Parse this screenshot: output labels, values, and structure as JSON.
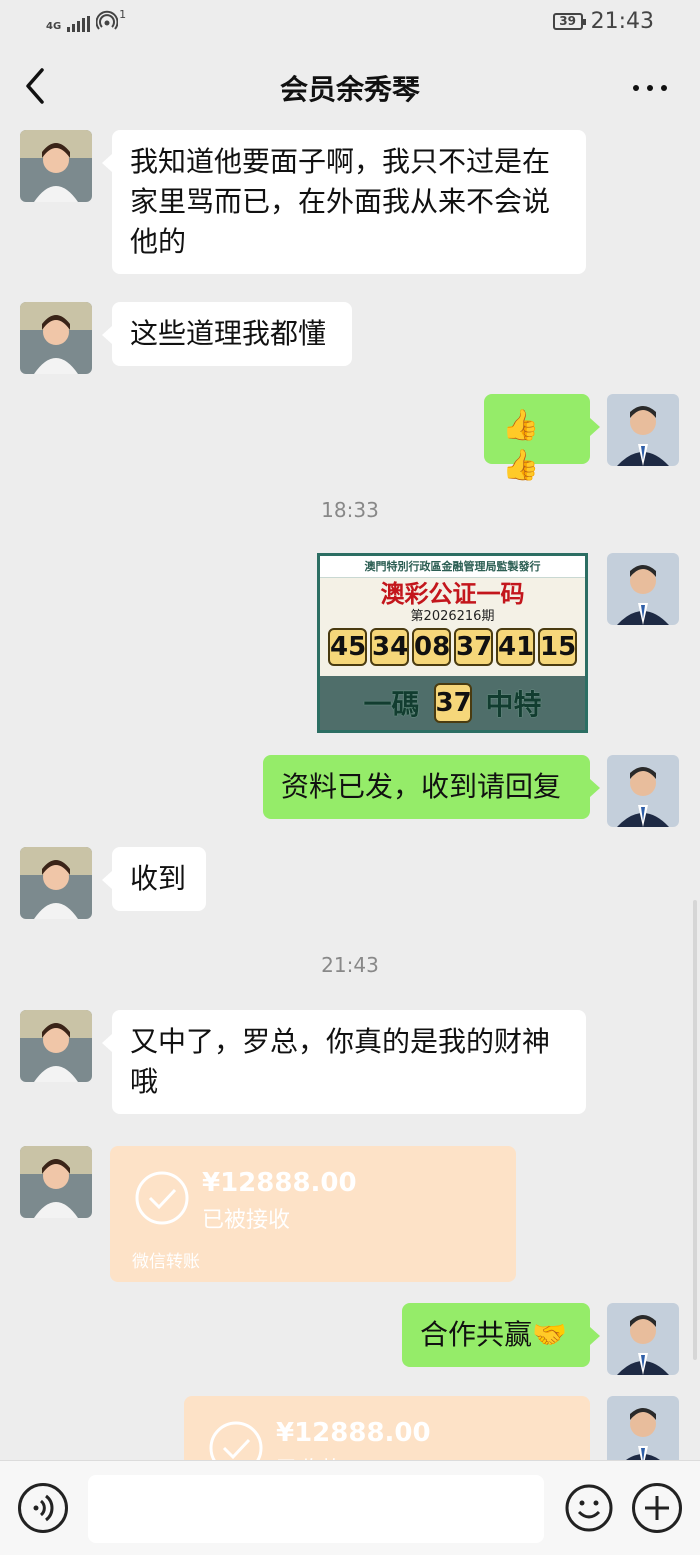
{
  "status_bar": {
    "network": "4G",
    "hotspot_count": "1",
    "battery": "39",
    "time": "21:43"
  },
  "nav": {
    "title": "会员余秀琴",
    "back_icon": "chevron-left-icon",
    "more_icon": "more-dots-icon"
  },
  "messages": [
    {
      "side": "left",
      "type": "text",
      "text": "我知道他要面子啊，我只不过是在家里骂而已，在外面我从来不会说他的"
    },
    {
      "side": "left",
      "type": "text",
      "text": "这些道理我都懂"
    },
    {
      "side": "right",
      "type": "emoji",
      "text": "👍👍"
    },
    {
      "type": "timestamp",
      "text": "18:33"
    },
    {
      "side": "right",
      "type": "image",
      "image": {
        "header": "澳門特別行政區金融管理局監製發行",
        "headline": "澳彩公证一码",
        "issue": "第2026216期",
        "numbers": [
          "45",
          "34",
          "08",
          "37",
          "41",
          "15"
        ],
        "band_left": "一碼",
        "special": "37",
        "band_right": "中特"
      }
    },
    {
      "side": "right",
      "type": "text",
      "text": "资料已发，收到请回复"
    },
    {
      "side": "left",
      "type": "text",
      "text": "收到"
    },
    {
      "type": "timestamp",
      "text": "21:43"
    },
    {
      "side": "left",
      "type": "text",
      "text": "又中了，罗总，你真的是我的财神哦"
    },
    {
      "side": "left",
      "type": "transfer",
      "amount": "¥12888.00",
      "status": "已被接收",
      "footer": "微信转账"
    },
    {
      "side": "right",
      "type": "text",
      "text": "合作共赢🤝"
    },
    {
      "side": "right",
      "type": "transfer",
      "amount": "¥12888.00",
      "status": "已收款"
    }
  ],
  "input_bar": {
    "voice_icon": "voice-icon",
    "emoji_icon": "emoji-icon",
    "plus_icon": "plus-icon",
    "placeholder": ""
  },
  "colors": {
    "background": "#ededed",
    "sent_bubble": "#95ec69",
    "received_bubble": "#ffffff",
    "transfer_card": "#fde2c7"
  }
}
